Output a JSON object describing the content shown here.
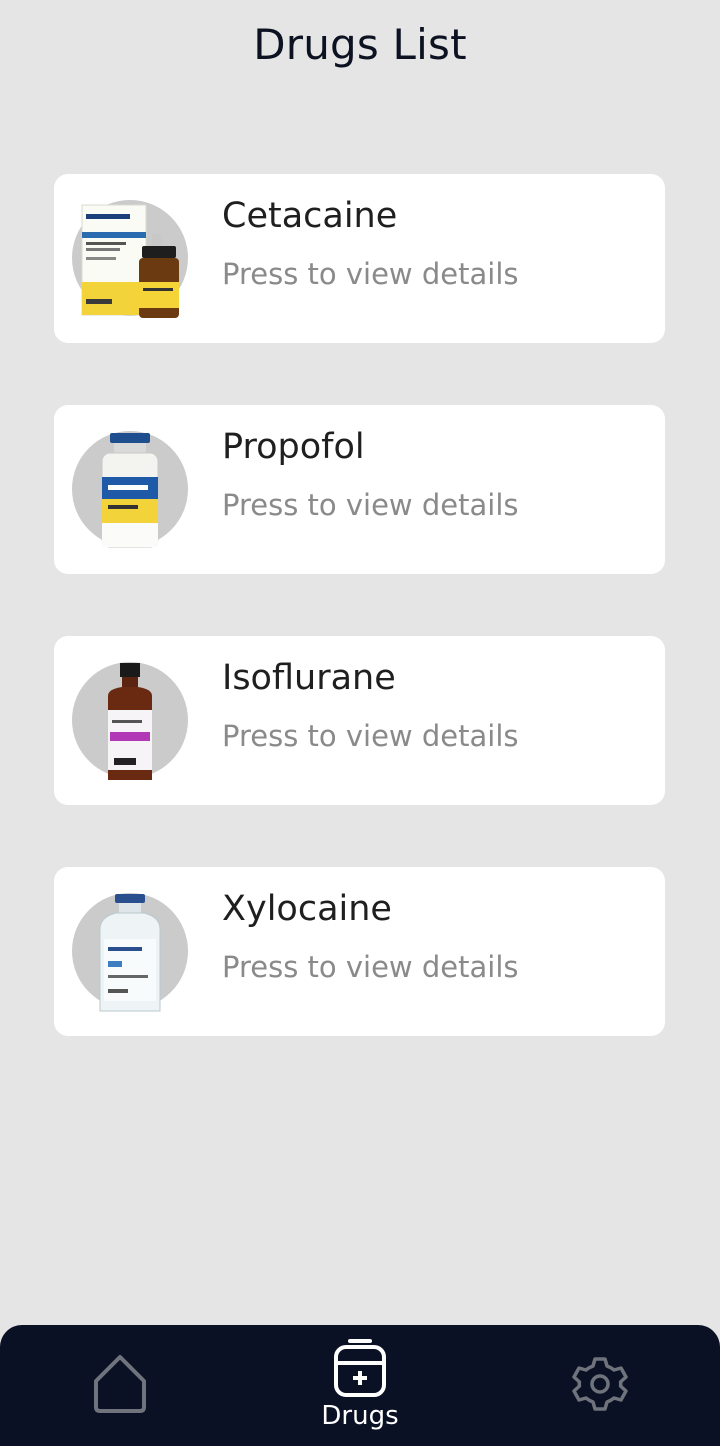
{
  "header": {
    "title": "Drugs List"
  },
  "drugs": [
    {
      "name": "Cetacaine",
      "subtitle": "Press to view details",
      "image": "cetacaine-product-image"
    },
    {
      "name": "Propofol",
      "subtitle": "Press to view details",
      "image": "propofol-vial-image"
    },
    {
      "name": "Isoflurane",
      "subtitle": "Press to view details",
      "image": "isoflurane-bottle-image"
    },
    {
      "name": "Xylocaine",
      "subtitle": "Press to view details",
      "image": "xylocaine-vial-image"
    }
  ],
  "bottom_nav": {
    "items": [
      {
        "icon": "home-icon",
        "label": ""
      },
      {
        "icon": "medical-case-icon",
        "label": "Drugs",
        "active": true
      },
      {
        "icon": "gear-icon",
        "label": ""
      }
    ]
  },
  "colors": {
    "background": "#e5e5e5",
    "card": "#ffffff",
    "nav_bar": "#0b1124",
    "title_text": "#0c1222",
    "subtitle_text": "#8a8a8a",
    "inactive_icon": "#6f737c"
  }
}
